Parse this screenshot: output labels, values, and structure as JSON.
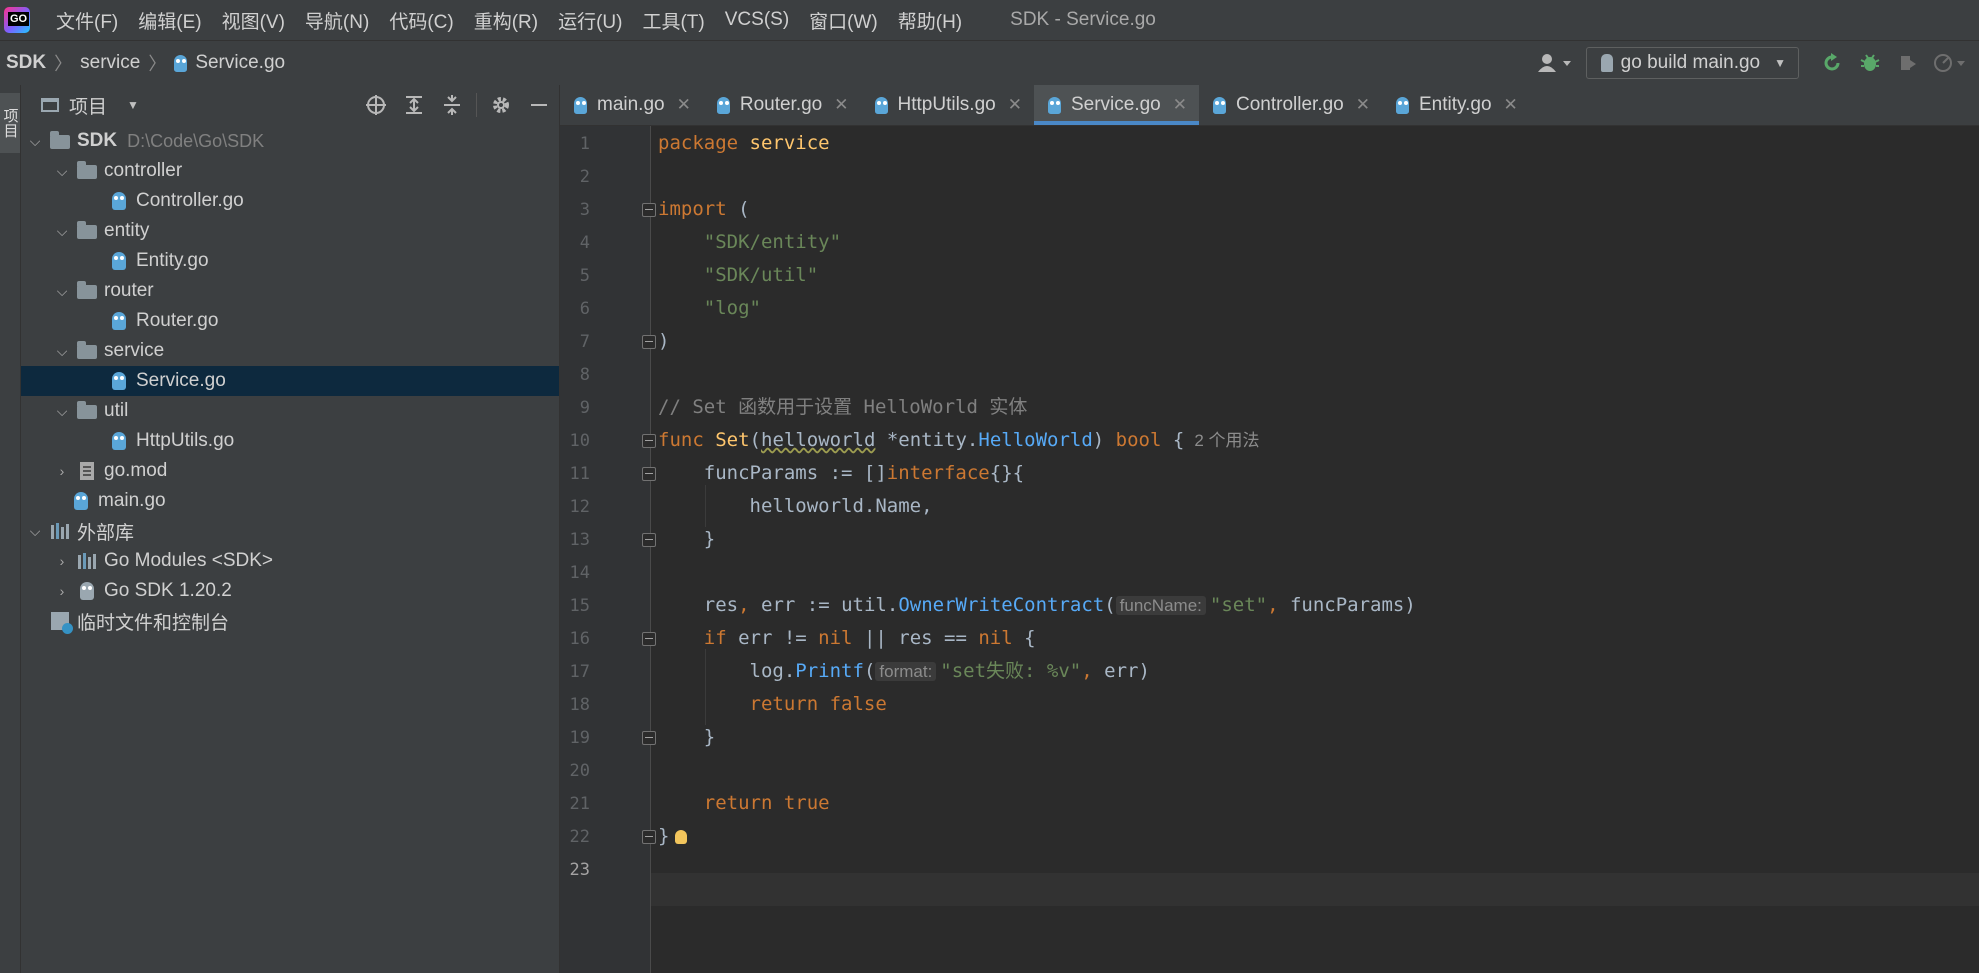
{
  "menubar": {
    "items": [
      "文件(F)",
      "编辑(E)",
      "视图(V)",
      "导航(N)",
      "代码(C)",
      "重构(R)",
      "运行(U)",
      "工具(T)",
      "VCS(S)",
      "窗口(W)",
      "帮助(H)"
    ],
    "window_title": "SDK - Service.go"
  },
  "navbar": {
    "breadcrumb": [
      "SDK",
      "service",
      "Service.go"
    ],
    "run_config": "go build main.go",
    "icons": [
      "user-icon",
      "run-icon",
      "debug-icon",
      "coverage-icon",
      "profile-icon"
    ]
  },
  "left_strip": {
    "label": "项目"
  },
  "project_panel": {
    "title": "项目",
    "tree": [
      {
        "label": "SDK",
        "path": "D:\\Code\\Go\\SDK",
        "icon": "folder-icon",
        "expanded": true
      },
      {
        "label": "controller",
        "icon": "folder-icon",
        "expanded": true
      },
      {
        "label": "Controller.go",
        "icon": "go-file-icon"
      },
      {
        "label": "entity",
        "icon": "folder-icon",
        "expanded": true
      },
      {
        "label": "Entity.go",
        "icon": "go-file-icon"
      },
      {
        "label": "router",
        "icon": "folder-icon",
        "expanded": true
      },
      {
        "label": "Router.go",
        "icon": "go-file-icon"
      },
      {
        "label": "service",
        "icon": "folder-icon",
        "expanded": true
      },
      {
        "label": "Service.go",
        "icon": "go-file-icon",
        "selected": true
      },
      {
        "label": "util",
        "icon": "folder-icon",
        "expanded": true
      },
      {
        "label": "HttpUtils.go",
        "icon": "go-file-icon"
      },
      {
        "label": "go.mod",
        "icon": "mod-file-icon",
        "expanded": false
      },
      {
        "label": "main.go",
        "icon": "go-file-icon"
      },
      {
        "label": "外部库",
        "icon": "library-icon",
        "expanded": true
      },
      {
        "label": "Go Modules <SDK>",
        "icon": "library-icon",
        "expanded": false
      },
      {
        "label": "Go SDK 1.20.2",
        "icon": "go-sdk-icon",
        "expanded": false
      },
      {
        "label": "临时文件和控制台",
        "icon": "scratch-icon"
      }
    ]
  },
  "editor": {
    "tabs": [
      {
        "label": "main.go",
        "active": false
      },
      {
        "label": "Router.go",
        "active": false
      },
      {
        "label": "HttpUtils.go",
        "active": false
      },
      {
        "label": "Service.go",
        "active": true
      },
      {
        "label": "Controller.go",
        "active": false
      },
      {
        "label": "Entity.go",
        "active": false
      }
    ],
    "line_numbers": [
      "1",
      "2",
      "3",
      "4",
      "5",
      "6",
      "7",
      "8",
      "9",
      "10",
      "11",
      "12",
      "13",
      "14",
      "15",
      "16",
      "17",
      "18",
      "19",
      "20",
      "21",
      "22",
      "23"
    ],
    "current_line": 23,
    "code": {
      "l1_kw": "package",
      "l1_name": "service",
      "l3_kw": "import",
      "l3_paren": "(",
      "l4": "\"SDK/entity\"",
      "l5": "\"SDK/util\"",
      "l6": "\"log\"",
      "l7": ")",
      "l9_comment": "// Set 函数用于设置 HelloWorld 实体",
      "l10_kw": "func",
      "l10_name": "Set",
      "l10_param": "helloworld",
      "l10_pkg": "*entity",
      "l10_type": "HelloWorld",
      "l10_ret": "bool",
      "l10_usage": "2 个用法",
      "l11_var": "funcParams",
      "l11_kw": "interface",
      "l12": "helloworld.Name,",
      "l13": "}",
      "l15_vars": "res",
      "l15_err": "err",
      "l15_pkg": "util",
      "l15_fn": "OwnerWriteContract",
      "l15_hint": "funcName:",
      "l15_str": "\"set\"",
      "l15_arg": "funcParams",
      "l16_kw": "if",
      "l16_nil": "nil",
      "l16_res": "res",
      "l17_pkg": "log",
      "l17_fn": "Printf",
      "l17_hint": "format:",
      "l17_str": "\"set失败: %v\"",
      "l17_arg": "err",
      "l18_kw": "return",
      "l18_val": "false",
      "l19": "}",
      "l21_kw": "return",
      "l21_val": "true",
      "l22": "}"
    }
  }
}
